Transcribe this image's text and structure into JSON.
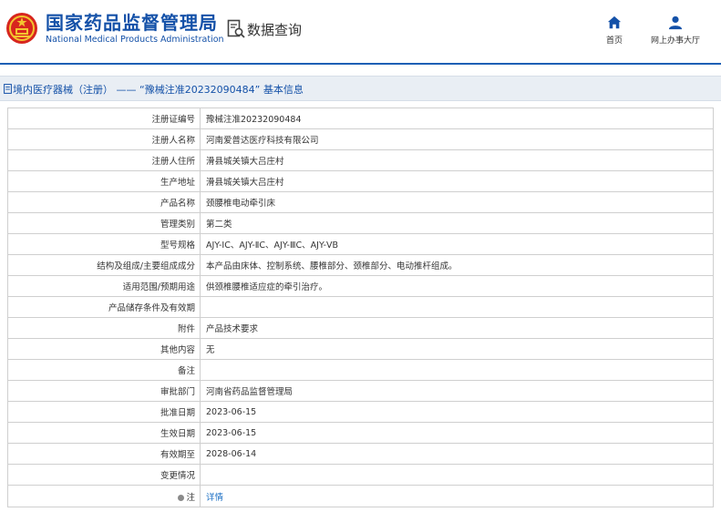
{
  "header": {
    "logo_cn": "国家药品监督管理局",
    "logo_en": "National Medical Products Administration",
    "emblem_icon": "national-emblem-icon",
    "query_icon": "document-search-icon",
    "query_label": "数据查询",
    "nav": [
      {
        "icon": "home-icon",
        "label": "首页"
      },
      {
        "icon": "person-icon",
        "label": "网上办事大厅"
      }
    ],
    "brand_color": "#1451a8"
  },
  "title_bar": {
    "icon": "document-icon",
    "text": "境内医疗器械（注册） —— “豫械注准20232090484” 基本信息"
  },
  "table": {
    "rows": [
      {
        "label": "注册证编号",
        "value": "豫械注准20232090484"
      },
      {
        "label": "注册人名称",
        "value": "河南爱普达医疗科技有限公司"
      },
      {
        "label": "注册人住所",
        "value": "滑县城关镇大吕庄村"
      },
      {
        "label": "生产地址",
        "value": "滑县城关镇大吕庄村"
      },
      {
        "label": "产品名称",
        "value": "颈腰椎电动牵引床"
      },
      {
        "label": "管理类别",
        "value": "第二类"
      },
      {
        "label": "型号规格",
        "value": "AJY-ⅠC、AJY-ⅡC、AJY-ⅢC、AJY-ⅤB"
      },
      {
        "label": "结构及组成/主要组成成分",
        "value": "本产品由床体、控制系统、腰椎部分、颈椎部分、电动推杆组成。"
      },
      {
        "label": "适用范围/预期用途",
        "value": "供颈椎腰椎适应症的牵引治疗。"
      },
      {
        "label": "产品储存条件及有效期",
        "value": ""
      },
      {
        "label": "附件",
        "value": "产品技术要求"
      },
      {
        "label": "其他内容",
        "value": "无"
      },
      {
        "label": "备注",
        "value": ""
      },
      {
        "label": "审批部门",
        "value": "河南省药品监督管理局"
      },
      {
        "label": "批准日期",
        "value": "2023-06-15"
      },
      {
        "label": "生效日期",
        "value": "2023-06-15"
      },
      {
        "label": "有效期至",
        "value": "2028-06-14"
      },
      {
        "label": "变更情况",
        "value": ""
      }
    ],
    "note_row": {
      "icon": "note-dot-icon",
      "label": "注",
      "link": "详情"
    }
  }
}
